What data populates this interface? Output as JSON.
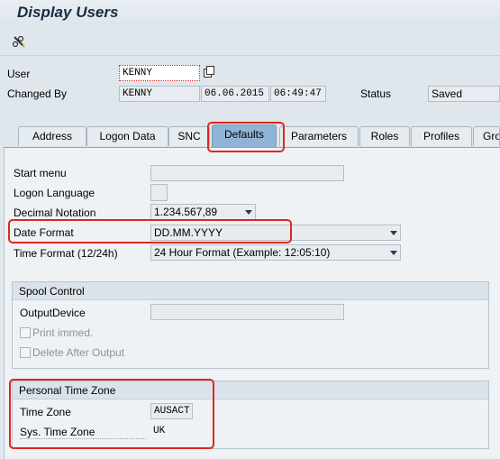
{
  "header": {
    "title": "Display Users"
  },
  "toolbar": {
    "edit_icon": "pen-glasses-icon"
  },
  "user": {
    "user_label": "User",
    "user_value": "KENNY",
    "changed_by_label": "Changed By",
    "changed_by_value": "KENNY",
    "changed_date": "06.06.2015",
    "changed_time": "06:49:47",
    "status_label": "Status",
    "status_value": "Saved"
  },
  "tabs": [
    {
      "label": "Address"
    },
    {
      "label": "Logon Data"
    },
    {
      "label": "SNC"
    },
    {
      "label": "Defaults"
    },
    {
      "label": "Parameters"
    },
    {
      "label": "Roles"
    },
    {
      "label": "Profiles"
    },
    {
      "label": "Gro"
    }
  ],
  "defaults": {
    "start_menu_label": "Start menu",
    "start_menu_value": "",
    "logon_language_label": "Logon Language",
    "logon_language_value": "",
    "decimal_notation_label": "Decimal Notation",
    "decimal_notation_value": "1.234.567,89",
    "date_format_label": "Date Format",
    "date_format_value": "DD.MM.YYYY",
    "time_format_label": "Time Format (12/24h)",
    "time_format_value": "24 Hour Format (Example: 12:05:10)"
  },
  "spool": {
    "title": "Spool Control",
    "output_device_label": "OutputDevice",
    "output_device_value": "",
    "print_immed_label": "Print immed.",
    "delete_after_output_label": "Delete After Output"
  },
  "timezone": {
    "title": "Personal Time Zone",
    "time_zone_label": "Time Zone",
    "time_zone_value": "AUSACT",
    "sys_time_zone_label": "Sys. Time Zone",
    "sys_time_zone_value": "UK"
  },
  "colors": {
    "highlight": "#e0261f",
    "active_tab": "#8fb4d6"
  }
}
